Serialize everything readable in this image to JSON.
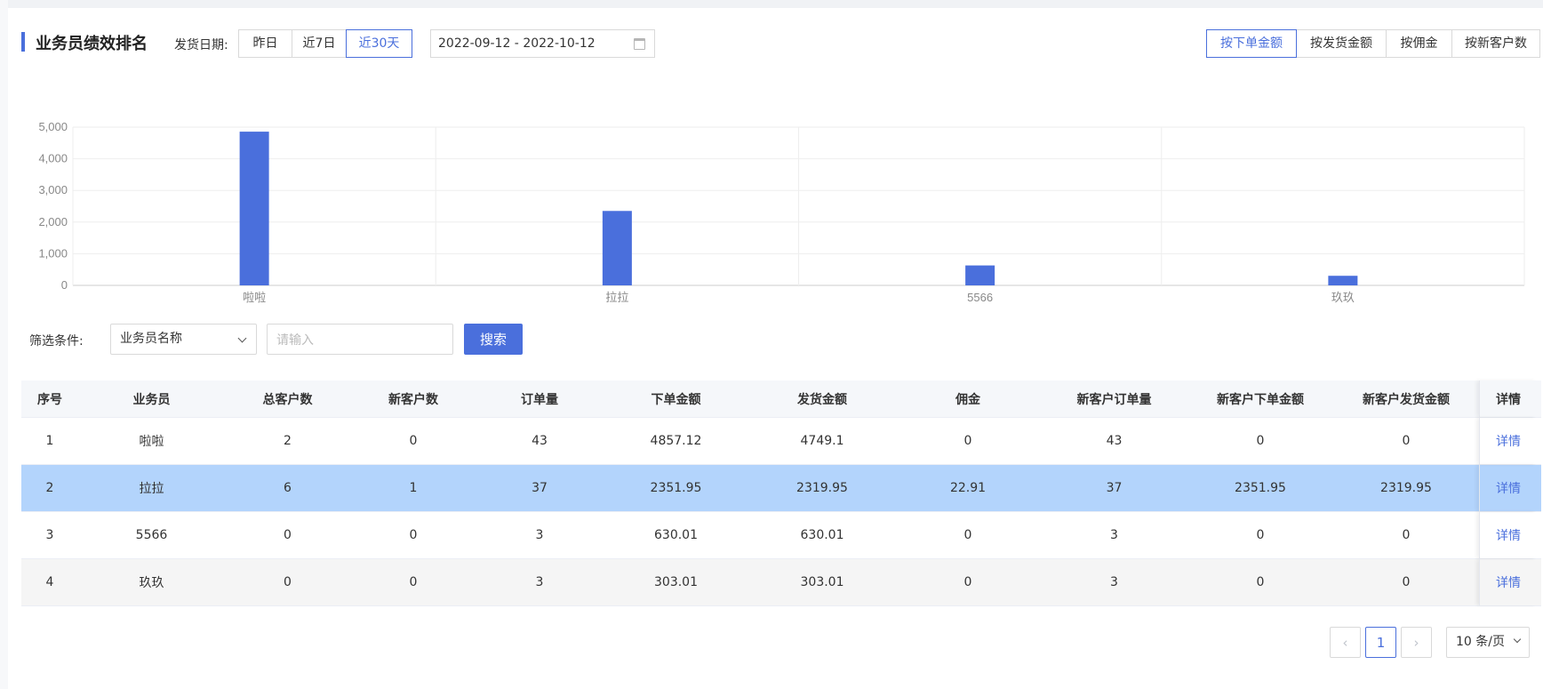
{
  "header": {
    "title": "业务员绩效排名",
    "date_label": "发货日期:",
    "quick_ranges": [
      "昨日",
      "近7日",
      "近30天"
    ],
    "active_quick_range": "近30天",
    "date_range": "2022-09-12 - 2022-10-12",
    "sort_options": [
      "按下单金额",
      "按发货金额",
      "按佣金",
      "按新客户数"
    ],
    "active_sort": "按下单金额"
  },
  "chart_data": {
    "type": "bar",
    "categories": [
      "啦啦",
      "拉拉",
      "5566",
      "玖玖"
    ],
    "values": [
      4857.12,
      2351.95,
      630.01,
      303.01
    ],
    "title": "",
    "xlabel": "",
    "ylabel": "",
    "ylim": [
      0,
      5000
    ],
    "yticks": [
      "0",
      "1,000",
      "2,000",
      "3,000",
      "4,000",
      "5,000"
    ],
    "grid": true,
    "bar_color": "#4a6fdc"
  },
  "filter": {
    "label": "筛选条件:",
    "select_value": "业务员名称",
    "input_placeholder": "请输入",
    "search_label": "搜索"
  },
  "table": {
    "columns": [
      "序号",
      "业务员",
      "总客户数",
      "新客户数",
      "订单量",
      "下单金额",
      "发货金额",
      "佣金",
      "新客户订单量",
      "新客户下单金额",
      "新客户发货金额",
      "详情"
    ],
    "rows": [
      [
        "1",
        "啦啦",
        "2",
        "0",
        "43",
        "4857.12",
        "4749.1",
        "0",
        "43",
        "0",
        "0",
        "详情"
      ],
      [
        "2",
        "拉拉",
        "6",
        "1",
        "37",
        "2351.95",
        "2319.95",
        "22.91",
        "37",
        "2351.95",
        "2319.95",
        "详情"
      ],
      [
        "3",
        "5566",
        "0",
        "0",
        "3",
        "630.01",
        "630.01",
        "0",
        "3",
        "0",
        "0",
        "详情"
      ],
      [
        "4",
        "玖玖",
        "0",
        "0",
        "3",
        "303.01",
        "303.01",
        "0",
        "3",
        "0",
        "0",
        "详情"
      ]
    ],
    "selected_row": 2
  },
  "pagination": {
    "prev": "‹",
    "page": "1",
    "next": "›",
    "page_size": "10 条/页"
  },
  "colors": {
    "accent": "#4a6fdc",
    "selected_row": "#b3d4fc"
  }
}
